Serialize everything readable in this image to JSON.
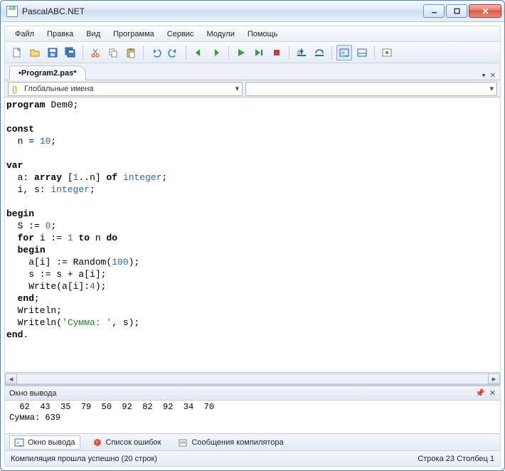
{
  "window": {
    "title": "PascalABC.NET"
  },
  "menu": {
    "items": [
      "Файл",
      "Правка",
      "Вид",
      "Программа",
      "Сервис",
      "Модули",
      "Помощь"
    ]
  },
  "tabs": {
    "active": "•Program2.pas*"
  },
  "nav": {
    "scope": "Глобальные имена",
    "member": ""
  },
  "code": {
    "lines": [
      {
        "t": [
          {
            "c": "kw",
            "v": "program"
          },
          {
            "v": " Dem0;"
          }
        ]
      },
      {
        "t": [
          {
            "v": ""
          }
        ]
      },
      {
        "t": [
          {
            "c": "kw",
            "v": "const"
          }
        ]
      },
      {
        "t": [
          {
            "v": "  n = "
          },
          {
            "c": "num",
            "v": "10"
          },
          {
            "v": ";"
          }
        ]
      },
      {
        "t": [
          {
            "v": ""
          }
        ]
      },
      {
        "t": [
          {
            "c": "kw",
            "v": "var"
          }
        ]
      },
      {
        "t": [
          {
            "v": "  a: "
          },
          {
            "c": "kw",
            "v": "array"
          },
          {
            "v": " ["
          },
          {
            "c": "num",
            "v": "1"
          },
          {
            "v": ".."
          },
          {
            "v": "n] "
          },
          {
            "c": "kw",
            "v": "of"
          },
          {
            "v": " "
          },
          {
            "c": "ty",
            "v": "integer"
          },
          {
            "v": ";"
          }
        ]
      },
      {
        "t": [
          {
            "v": "  i, s: "
          },
          {
            "c": "ty",
            "v": "integer"
          },
          {
            "v": ";"
          }
        ]
      },
      {
        "t": [
          {
            "v": ""
          }
        ]
      },
      {
        "t": [
          {
            "c": "kw",
            "v": "begin"
          }
        ]
      },
      {
        "t": [
          {
            "v": "  S := "
          },
          {
            "c": "num",
            "v": "0"
          },
          {
            "v": ";"
          }
        ]
      },
      {
        "t": [
          {
            "v": "  "
          },
          {
            "c": "kw",
            "v": "for"
          },
          {
            "v": " i := "
          },
          {
            "c": "num",
            "v": "1"
          },
          {
            "v": " "
          },
          {
            "c": "kw",
            "v": "to"
          },
          {
            "v": " n "
          },
          {
            "c": "kw",
            "v": "do"
          }
        ]
      },
      {
        "t": [
          {
            "v": "  "
          },
          {
            "c": "kw",
            "v": "begin"
          }
        ]
      },
      {
        "t": [
          {
            "v": "    a[i] := Random("
          },
          {
            "c": "num",
            "v": "100"
          },
          {
            "v": ");"
          }
        ]
      },
      {
        "t": [
          {
            "v": "    s := s + a[i];"
          }
        ]
      },
      {
        "t": [
          {
            "v": "    Write(a[i]:"
          },
          {
            "c": "num",
            "v": "4"
          },
          {
            "v": ");"
          }
        ]
      },
      {
        "t": [
          {
            "v": "  "
          },
          {
            "c": "kw",
            "v": "end"
          },
          {
            "v": ";"
          }
        ]
      },
      {
        "t": [
          {
            "v": "  Writeln;"
          }
        ]
      },
      {
        "t": [
          {
            "v": "  Writeln("
          },
          {
            "c": "str",
            "v": "'Сумма: '"
          },
          {
            "v": ", s);"
          }
        ]
      },
      {
        "t": [
          {
            "c": "kw",
            "v": "end"
          },
          {
            "v": "."
          }
        ]
      }
    ]
  },
  "output": {
    "title": "Окно вывода",
    "body": "  62  43  35  79  50  92  82  92  34  70\nСумма: 639"
  },
  "bottomtabs": {
    "items": [
      {
        "label": "Окно вывода",
        "active": true
      },
      {
        "label": "Список ошибок",
        "active": false
      },
      {
        "label": "Сообщения компилятора",
        "active": false
      }
    ]
  },
  "status": {
    "left": "Компиляция прошла успешно (20 строк)",
    "right": "Строка  23  Столбец  1"
  }
}
